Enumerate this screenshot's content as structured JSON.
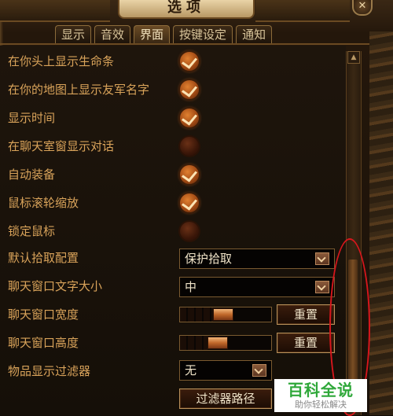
{
  "window": {
    "title": "选项",
    "close_symbol": "✕"
  },
  "tabs": [
    {
      "label": "显示",
      "active": false
    },
    {
      "label": "音效",
      "active": false
    },
    {
      "label": "界面",
      "active": true
    },
    {
      "label": "按键设定",
      "active": false
    },
    {
      "label": "通知",
      "active": false
    }
  ],
  "settings": {
    "checkboxes": [
      {
        "label": "在你头上显示生命条",
        "checked": true
      },
      {
        "label": "在你的地图上显示友军名字",
        "checked": true
      },
      {
        "label": "显示时间",
        "checked": true
      },
      {
        "label": "在聊天室窗显示对话",
        "checked": false
      },
      {
        "label": "自动装备",
        "checked": true
      },
      {
        "label": "鼠标滚轮缩放",
        "checked": true
      },
      {
        "label": "锁定鼠标",
        "checked": false
      }
    ],
    "pickup_config": {
      "label": "默认拾取配置",
      "value": "保护拾取"
    },
    "chat_font_size": {
      "label": "聊天窗口文字大小",
      "value": "中"
    },
    "chat_width": {
      "label": "聊天窗口宽度",
      "slider_level": 0.46,
      "reset_label": "重置"
    },
    "chat_height": {
      "label": "聊天窗口高度",
      "slider_level": 0.38,
      "reset_label": "重置"
    },
    "item_filter": {
      "label": "物品显示过滤器",
      "value": "无",
      "path_button": "过滤器路径"
    }
  },
  "watermark": {
    "title": "百科全说",
    "subtitle": "助你轻松解决"
  },
  "colors": {
    "label": "#d9a35a",
    "accent": "#c0682a",
    "annotation": "#d8161c",
    "watermark_green": "#2fa83a"
  }
}
